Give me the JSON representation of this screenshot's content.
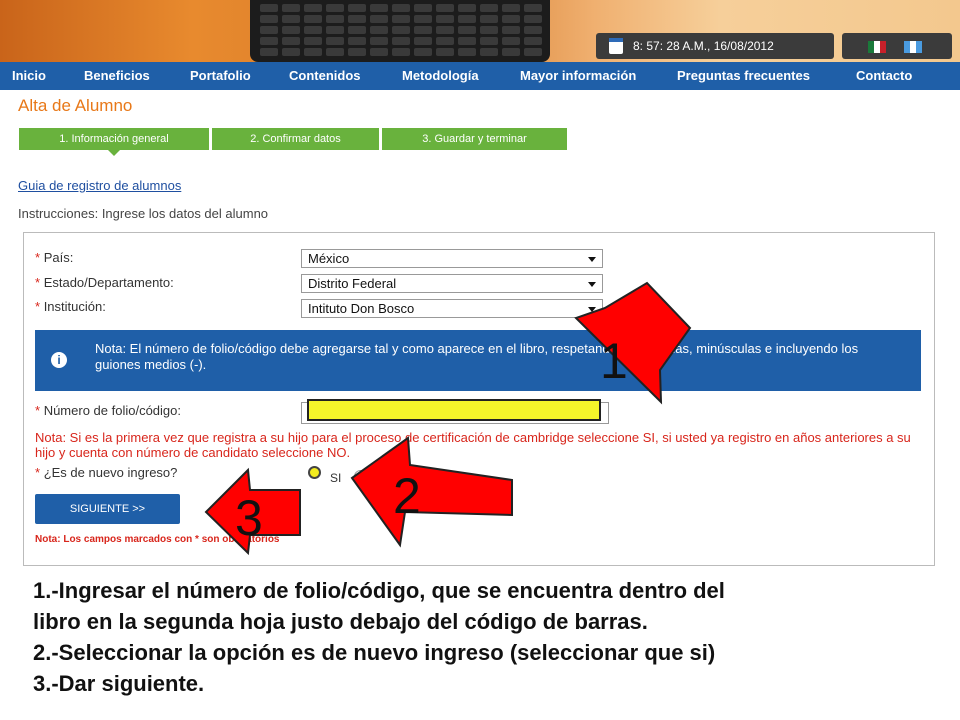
{
  "header": {
    "datetime": "8: 57: 28 A.M., 16/08/2012",
    "calendar_icon": "calendar-icon",
    "flags": [
      "mexico-flag-icon",
      "guatemala-flag-icon"
    ]
  },
  "nav": {
    "items": [
      "Inicio",
      "Beneficios",
      "Portafolio",
      "Contenidos",
      "Metodología",
      "Mayor información",
      "Preguntas frecuentes",
      "Contacto"
    ]
  },
  "page": {
    "title": "Alta de Alumno",
    "steps": [
      "1. Información general",
      "2. Confirmar datos",
      "3. Guardar y terminar"
    ],
    "guide_link": "Guia de registro de alumnos",
    "instructions": "Instrucciones: Ingrese los datos del alumno"
  },
  "form": {
    "required_mark": "*",
    "pais_label": "País:",
    "pais_value": "México",
    "estado_label": "Estado/Departamento:",
    "estado_value": "Distrito Federal",
    "institucion_label": "Institución:",
    "institucion_value": "Intituto Don Bosco",
    "info_note": "Nota: El número de folio/código debe agregarse tal y como aparece en el libro, respetando mayúsculas, minúsculas e incluyendo los guiones medios (-).",
    "folio_label": "Número de folio/código:",
    "folio_value": "",
    "cambridge_note": "Nota: Si es la primera vez que registra a su hijo para el proceso de certificación de cambridge seleccione SI, si usted ya registro en años anteriores a su hijo y cuenta con número de candidato seleccione NO.",
    "nuevo_ingreso_label": "¿Es de nuevo ingreso?",
    "radio_si_label": "SI",
    "next_button": "SIGUIENTE >>",
    "required_note": "Nota: Los campos marcados con * son obligatorios"
  },
  "annotations": {
    "arrow_numbers": [
      "1",
      "2",
      "3"
    ],
    "arrow_color": "#ff0000",
    "highlight_color": "#f5f52a"
  },
  "instructions_text": {
    "lines": [
      "1.-Ingresar el número de folio/código, que se encuentra dentro del",
      "libro en la segunda hoja justo debajo del código de barras.",
      "2.-Seleccionar la opción es de nuevo ingreso (seleccionar que si)",
      "3.-Dar siguiente."
    ]
  },
  "colors": {
    "nav_blue": "#1f5fa8",
    "step_green": "#69b23d",
    "title_orange": "#e87818",
    "note_red": "#d8261c"
  }
}
